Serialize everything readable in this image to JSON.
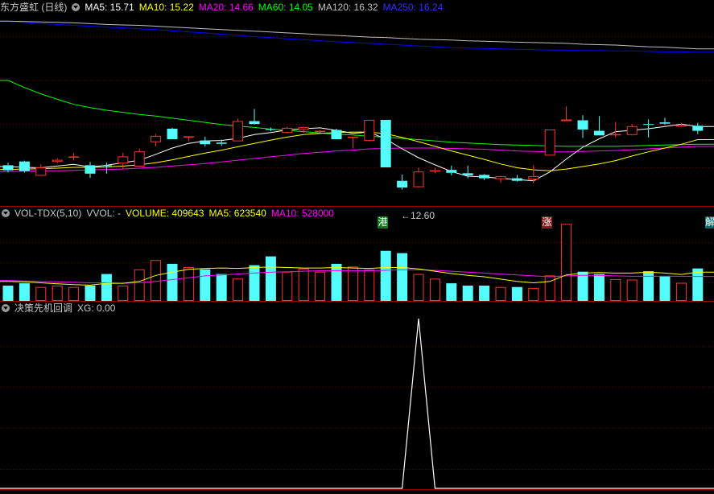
{
  "main_header": {
    "stock": "东方盛虹 (日线)",
    "ma5": "MA5: 15.71",
    "ma10": "MA10: 15.22",
    "ma20": "MA20: 14.66",
    "ma60": "MA60: 14.05",
    "ma120": "MA120: 16.32",
    "ma250": "MA250: 16.24"
  },
  "vol_header": {
    "name": "VOL-TDX(5,10)",
    "vvol": "VVOL: -",
    "volume": "VOLUME: 409643",
    "ma5": "MA5: 623540",
    "ma10": "MA10: 528000"
  },
  "ind_header": {
    "name": "决策先机回调",
    "xg": "XG: 0.00"
  },
  "markers": {
    "gang": "港",
    "zhang": "涨",
    "jie": "解",
    "low_label": "←12.60"
  },
  "colors": {
    "up": "#ff3232",
    "down": "#54fcfc",
    "ma5": "#ffffff",
    "ma10": "#ffff00",
    "ma20": "#ff00ff",
    "ma60": "#00ff00",
    "ma120": "#c0c0c0",
    "ma250": "#0000ff"
  },
  "chart_data": [
    {
      "type": "candlestick",
      "ohlc": [
        [
          13.55,
          13.61,
          13.38,
          13.43
        ],
        [
          13.64,
          13.66,
          13.38,
          13.41
        ],
        [
          13.3,
          13.57,
          13.31,
          13.5
        ],
        [
          13.63,
          13.72,
          13.6,
          13.68
        ],
        [
          13.76,
          13.84,
          13.67,
          13.76
        ],
        [
          13.55,
          13.63,
          13.25,
          13.35
        ],
        [
          13.55,
          13.61,
          13.35,
          13.54
        ],
        [
          13.59,
          13.85,
          13.47,
          13.76
        ],
        [
          13.52,
          13.94,
          13.54,
          13.88
        ],
        [
          14.1,
          14.29,
          14.0,
          14.25
        ],
        [
          14.42,
          14.44,
          14.18,
          14.17
        ],
        [
          14.22,
          14.2,
          14.12,
          14.24
        ],
        [
          14.14,
          14.23,
          14.0,
          14.05
        ],
        [
          14.09,
          14.16,
          14.01,
          14.06
        ],
        [
          14.12,
          14.66,
          14.12,
          14.6
        ],
        [
          14.6,
          14.89,
          14.52,
          14.53
        ],
        [
          14.41,
          14.45,
          14.36,
          14.4
        ],
        [
          14.32,
          14.47,
          14.3,
          14.44
        ],
        [
          14.39,
          14.47,
          14.32,
          14.46
        ],
        [
          14.36,
          14.39,
          14.33,
          14.37
        ],
        [
          14.39,
          14.42,
          14.21,
          14.17
        ],
        [
          14.21,
          14.16,
          13.95,
          14.23
        ],
        [
          14.13,
          14.54,
          14.12,
          14.63
        ],
        [
          14.63,
          14.63,
          13.5,
          13.5
        ],
        [
          13.18,
          13.33,
          12.97,
          13.02
        ],
        [
          13.03,
          13.49,
          13.02,
          13.4
        ],
        [
          13.4,
          13.49,
          13.36,
          13.43
        ],
        [
          13.44,
          13.54,
          13.31,
          13.37
        ],
        [
          13.36,
          13.54,
          13.24,
          13.31
        ],
        [
          13.32,
          13.34,
          13.2,
          13.24
        ],
        [
          13.22,
          13.3,
          13.13,
          13.29
        ],
        [
          13.24,
          13.32,
          13.16,
          13.18
        ],
        [
          13.21,
          13.55,
          13.13,
          13.29
        ],
        [
          13.78,
          14.4,
          13.78,
          14.4
        ],
        [
          14.6,
          14.95,
          14.64,
          14.64
        ],
        [
          14.62,
          14.74,
          14.2,
          14.4
        ],
        [
          14.37,
          14.72,
          14.3,
          14.26
        ],
        [
          14.29,
          14.58,
          14.21,
          14.29
        ],
        [
          14.27,
          14.53,
          14.26,
          14.48
        ],
        [
          14.53,
          14.64,
          14.21,
          14.51
        ],
        [
          14.57,
          14.68,
          14.51,
          14.54
        ],
        [
          14.5,
          14.56,
          14.51,
          14.5
        ],
        [
          14.49,
          14.56,
          14.29,
          14.37
        ]
      ],
      "ma5": [
        13.52,
        13.5,
        13.49,
        13.53,
        13.57,
        13.51,
        13.55,
        13.61,
        13.67,
        13.81,
        13.96,
        14.07,
        14.13,
        14.14,
        14.19,
        14.28,
        14.33,
        14.39,
        14.42,
        14.44,
        14.38,
        14.31,
        14.34,
        14.17,
        13.94,
        13.73,
        13.56,
        13.4,
        13.29,
        13.27,
        13.24,
        13.21,
        13.18,
        13.39,
        13.7,
        13.98,
        14.18,
        14.35,
        14.38,
        14.42,
        14.47,
        14.53,
        14.47
      ],
      "ma10": [
        13.45,
        13.46,
        13.47,
        13.48,
        13.5,
        13.5,
        13.51,
        13.53,
        13.56,
        13.61,
        13.68,
        13.76,
        13.84,
        13.91,
        13.99,
        14.07,
        14.15,
        14.22,
        14.28,
        14.31,
        14.33,
        14.34,
        14.34,
        14.3,
        14.21,
        14.11,
        14.0,
        13.89,
        13.79,
        13.69,
        13.58,
        13.49,
        13.44,
        13.42,
        13.46,
        13.52,
        13.58,
        13.66,
        13.77,
        13.87,
        13.96,
        14.05,
        14.16
      ],
      "ma20": [
        13.4,
        13.41,
        13.42,
        13.42,
        13.43,
        13.44,
        13.45,
        13.46,
        13.48,
        13.5,
        13.53,
        13.56,
        13.59,
        13.63,
        13.67,
        13.71,
        13.75,
        13.79,
        13.83,
        13.86,
        13.89,
        13.91,
        13.94,
        13.95,
        13.96,
        13.96,
        13.96,
        13.95,
        13.94,
        13.93,
        13.91,
        13.89,
        13.88,
        13.87,
        13.87,
        13.88,
        13.89,
        13.9,
        13.92,
        13.94,
        13.96,
        13.98,
        14.0
      ],
      "ma60": [
        15.57,
        15.4,
        15.25,
        15.12,
        15.0,
        14.92,
        14.86,
        14.81,
        14.76,
        14.72,
        14.67,
        14.62,
        14.57,
        14.52,
        14.48,
        14.45,
        14.41,
        14.38,
        14.35,
        14.32,
        14.29,
        14.27,
        14.24,
        14.22,
        14.19,
        14.16,
        14.13,
        14.1,
        14.08,
        14.06,
        14.04,
        14.03,
        14.02,
        14.01,
        14.0,
        14.0,
        14.0,
        14.0,
        14.01,
        14.02,
        14.03,
        14.04,
        14.05
      ],
      "ma120": [
        16.98,
        16.97,
        16.96,
        16.95,
        16.94,
        16.92,
        16.9,
        16.89,
        16.88,
        16.86,
        16.84,
        16.82,
        16.8,
        16.78,
        16.76,
        16.74,
        16.72,
        16.7,
        16.68,
        16.66,
        16.64,
        16.62,
        16.6,
        16.59,
        16.57,
        16.55,
        16.54,
        16.53,
        16.51,
        16.5,
        16.49,
        16.48,
        16.47,
        16.46,
        16.45,
        16.43,
        16.42,
        16.41,
        16.39,
        16.37,
        16.36,
        16.34,
        16.32
      ],
      "ma250": [
        16.98,
        16.95,
        16.92,
        16.9,
        16.88,
        16.86,
        16.84,
        16.82,
        16.8,
        16.78,
        16.75,
        16.72,
        16.7,
        16.67,
        16.64,
        16.61,
        16.59,
        16.56,
        16.54,
        16.51,
        16.49,
        16.47,
        16.45,
        16.43,
        16.41,
        16.39,
        16.37,
        16.35,
        16.34,
        16.33,
        16.32,
        16.31,
        16.3,
        16.29,
        16.29,
        16.28,
        16.28,
        16.27,
        16.27,
        16.26,
        16.25,
        16.25,
        16.24
      ],
      "ylim": [
        12.6,
        17.1
      ]
    },
    {
      "type": "bar",
      "volume": [
        330000,
        380000,
        300000,
        330000,
        300000,
        330000,
        580000,
        330000,
        680000,
        880000,
        800000,
        730000,
        680000,
        580000,
        480000,
        770000,
        960000,
        630000,
        700000,
        630000,
        800000,
        740000,
        680000,
        1080000,
        1030000,
        580000,
        480000,
        380000,
        330000,
        330000,
        300000,
        300000,
        280000,
        550000,
        1660000,
        630000,
        580000,
        470000,
        460000,
        640000,
        540000,
        390000,
        700000
      ],
      "vol_ma5": [
        420000,
        410000,
        390000,
        370000,
        350000,
        340000,
        380000,
        380000,
        420000,
        550000,
        620000,
        680000,
        700000,
        710000,
        700000,
        720000,
        730000,
        720000,
        710000,
        710000,
        720000,
        710000,
        700000,
        720000,
        720000,
        690000,
        640000,
        590000,
        550000,
        520000,
        470000,
        420000,
        390000,
        420000,
        560000,
        600000,
        610000,
        600000,
        600000,
        620000,
        600000,
        570000,
        620000
      ],
      "vol_ma10": [
        440000,
        430000,
        420000,
        410000,
        400000,
        390000,
        390000,
        380000,
        390000,
        420000,
        460000,
        500000,
        540000,
        560000,
        580000,
        600000,
        620000,
        630000,
        640000,
        650000,
        650000,
        650000,
        650000,
        660000,
        670000,
        670000,
        660000,
        640000,
        620000,
        600000,
        580000,
        560000,
        540000,
        520000,
        540000,
        550000,
        550000,
        540000,
        530000,
        530000,
        530000,
        530000,
        528000
      ],
      "ylim": [
        0,
        1700000
      ]
    },
    {
      "type": "line",
      "xg": [
        0,
        0,
        0,
        0,
        0,
        0,
        0,
        0,
        0,
        0,
        0,
        0,
        0,
        0,
        0,
        0,
        0,
        0,
        0,
        0,
        0,
        0,
        0,
        0,
        0,
        1,
        0,
        0,
        0,
        0,
        0,
        0,
        0,
        0,
        0,
        0,
        0,
        0,
        0,
        0,
        0,
        0,
        0
      ],
      "ylim": [
        0,
        1
      ]
    }
  ]
}
